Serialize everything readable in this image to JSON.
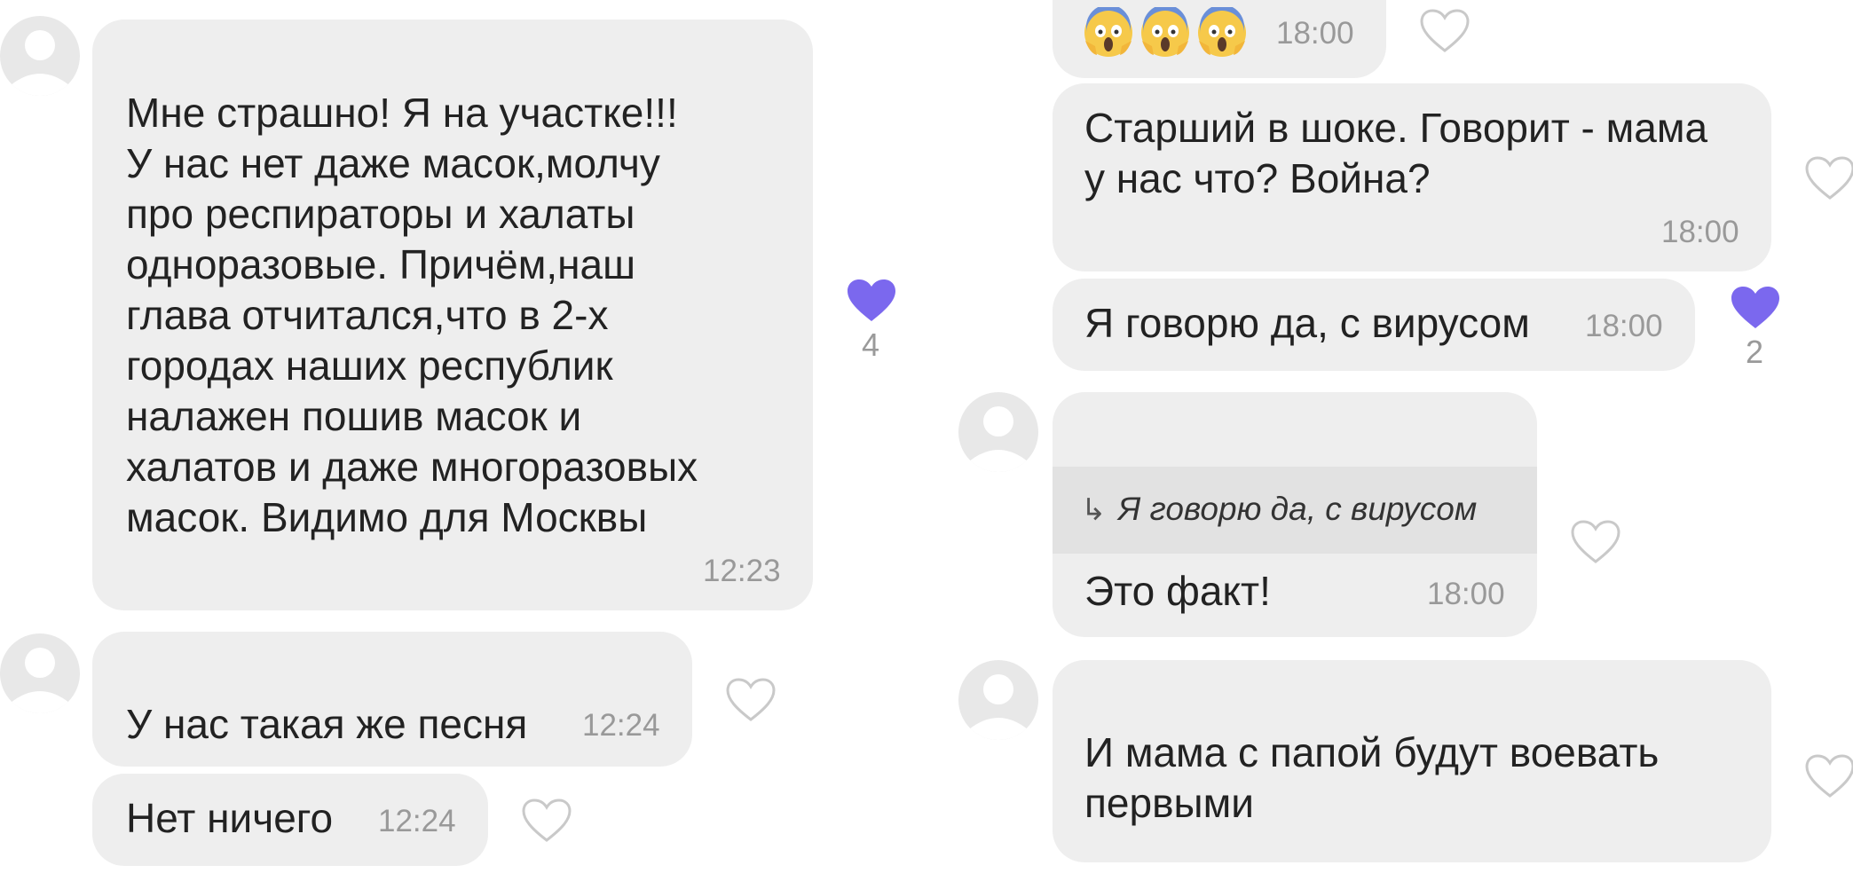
{
  "colors": {
    "bubble": "#eeeeee",
    "quote_bg": "#e2e2e2",
    "heart_liked": "#7b68ee",
    "heart_outline": "#c9c9c9",
    "time": "#999999"
  },
  "left_column": {
    "messages": [
      {
        "text": "Мне страшно! Я на участке!!!\nУ нас нет даже масок,молчу\nпро респираторы и халаты\nодноразовые. Причём,наш\nглава отчитался,что в 2-х\nгородах наших республик\nналажен пошив масок и\nхалатов и даже многоразовых\nмасок. Видимо для Москвы",
        "time": "12:23",
        "liked": true,
        "likes": "4"
      },
      {
        "text": "У нас такая же песня",
        "time": "12:24",
        "liked": false
      },
      {
        "text": "Нет ничего",
        "time": "12:24",
        "liked": false
      }
    ]
  },
  "right_column": {
    "messages": [
      {
        "emoji": [
          "face-screaming-in-fear-icon",
          "face-screaming-in-fear-icon",
          "face-screaming-in-fear-icon"
        ],
        "time": "18:00",
        "liked": false
      },
      {
        "text": "Старший в шоке. Говорит - мама\nу нас что? Война?",
        "time": "18:00",
        "liked": false
      },
      {
        "text": "Я говорю да, с вирусом",
        "time": "18:00",
        "liked": true,
        "likes": "2"
      },
      {
        "quote_arrow": "↳",
        "quote": "Я говорю да, с вирусом",
        "text": "Это факт!",
        "time": "18:00",
        "liked": false
      },
      {
        "text": "И мама с папой будут воевать\nпервыми",
        "liked": false
      }
    ]
  }
}
